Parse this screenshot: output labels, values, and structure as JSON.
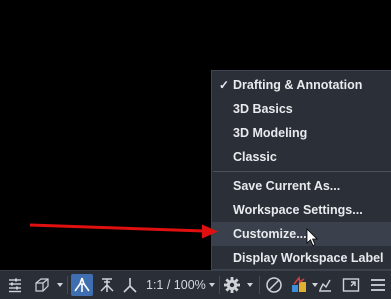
{
  "workspace_menu": {
    "items": [
      {
        "label": "Drafting & Annotation",
        "checked": true
      },
      {
        "label": "3D Basics"
      },
      {
        "label": "3D Modeling"
      },
      {
        "label": "Classic"
      },
      {
        "label": "Save Current As..."
      },
      {
        "label": "Workspace Settings..."
      },
      {
        "label": "Customize...",
        "hovered": true
      },
      {
        "label": "Display Workspace Label"
      }
    ],
    "check_glyph": "✓"
  },
  "status_bar": {
    "annotation_scale": "1:1 / 100%",
    "icons": [
      "customization-icon",
      "isometric-drafting-icon",
      "annotation-visibility-icon",
      "auto-scale-icon",
      "annotation-scale-icon",
      "workspace-gear-icon",
      "isolate-objects-icon",
      "hardware-acceleration-icon",
      "clean-screen-icon",
      "menu-icon"
    ]
  },
  "colors": {
    "menu_bg": "#2b3038",
    "menu_hover": "#3a414c",
    "statusbar_bg": "#2a2f37",
    "active_button": "#3f6fb1",
    "annotation_arrow": "#e01010"
  }
}
